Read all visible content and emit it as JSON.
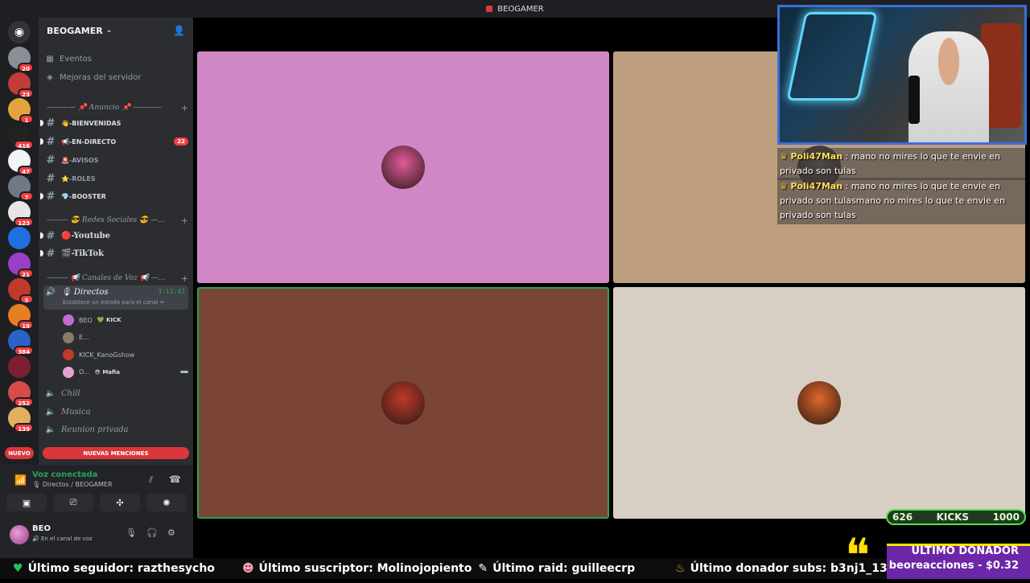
{
  "window": {
    "title": "BEOGAMER"
  },
  "servers": [
    {
      "badge": "20",
      "color": "#8a8f95"
    },
    {
      "badge": "23",
      "color": "#c23b3b"
    },
    {
      "badge": "1",
      "color": "#e3a53b"
    },
    {
      "badge": "416",
      "color": "#222222"
    },
    {
      "badge": "47",
      "color": "#f2f3f5"
    },
    {
      "badge": "7",
      "color": "#6f7a85"
    },
    {
      "badge": "123",
      "color": "#e6e6e6"
    },
    {
      "badge": "",
      "color": "#1f6fe0"
    },
    {
      "badge": "21",
      "color": "#9b3fc9"
    },
    {
      "badge": "5",
      "color": "#c0392b"
    },
    {
      "badge": "19",
      "color": "#e67e22"
    },
    {
      "badge": "384",
      "color": "#2a62c9"
    },
    {
      "badge": "",
      "color": "#7d1f2f"
    },
    {
      "badge": "252",
      "color": "#d84b4b"
    },
    {
      "badge": "139",
      "color": "#e0b060"
    }
  ],
  "sidebar": {
    "server_name": "BEOGAMER",
    "events": "Eventos",
    "boosts": "Mejoras del servidor",
    "cat_announce": "———— 📌 Anuncio 📌 ————",
    "channels": [
      {
        "name": "👋-BIENVENIDAS",
        "badge": ""
      },
      {
        "name": "📢-EN-DIRECTO",
        "badge": "22"
      },
      {
        "name": "🚨-AVISOS",
        "badge": ""
      },
      {
        "name": "⭐-ROLES",
        "badge": ""
      },
      {
        "name": "💎-BOOSTER",
        "badge": ""
      }
    ],
    "cat_social": "——— 😎 Redes Sociales 😎 —...",
    "social_channels": [
      "🔴-Youtube",
      "🎬-TikTok"
    ],
    "cat_voice": "——— 📢 Canales de Voz 📢 —...",
    "voice_active": {
      "name": "🎙 Directos",
      "time": "3:11:42",
      "status": "Establece un estado para el canal ✏"
    },
    "voice_users": [
      {
        "name": "BEO",
        "tag": "💚 KICK",
        "color": "#c46bd1"
      },
      {
        "name": "E...",
        "tag": "",
        "color": "#8a7a6a"
      },
      {
        "name": "KICK_KanoGshow",
        "tag": "",
        "color": "#c0392b"
      },
      {
        "name": "O...",
        "tag": "😎 Mafia",
        "color": "#e4a0d0"
      }
    ],
    "voice_channels": [
      "Chill",
      "Musica",
      "Reunion privada"
    ],
    "new_tag": "NUEVO",
    "new_mentions": "NUEVAS MENCIONES"
  },
  "voice_panel": {
    "connected": "Voz conectada",
    "location": "🎙 Directos / BEOGAMER"
  },
  "user_panel": {
    "name": "BEO",
    "status": "🔊 En el canal de voz"
  },
  "tiles": [
    {
      "color": "#cf87c6",
      "face": "#e05a9a"
    },
    {
      "color": "#bd9e7f",
      "face": "#6a5a4a"
    },
    {
      "color": "#7a4536",
      "face": "#c0392b"
    },
    {
      "color": "#d7cfc3",
      "face": "#e0682a"
    }
  ],
  "chat": [
    {
      "user": "Poli47Man",
      "text": ": mano no mires lo que te envie en privado son tulas"
    },
    {
      "user": "Poli47Man",
      "text": ": mano no mires lo que te envie en privado son tulasmano no mires lo que te envie en privado son tulas"
    }
  ],
  "kicks": {
    "current": "626",
    "label": "KICKS",
    "goal": "1000",
    "progress": 0.626
  },
  "ticker": {
    "follower": "Último seguidor: razthesycho",
    "subscriber": "Último suscriptor: Molinojopiento",
    "raid": "Último raid: guilleecrp",
    "donor_subs": "Último donador subs: b3nj1_13"
  },
  "donor": {
    "title": "ULTIMO DONADOR",
    "line": "beoreacciones - $0.32"
  }
}
